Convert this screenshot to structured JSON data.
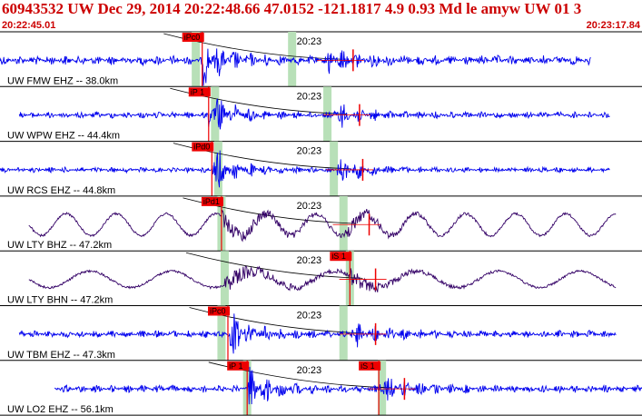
{
  "header": {
    "title": "60943532 UW Dec 29, 2014 20:22:48.66   47.0152 -121.1817  4.9 0.93 Md le amyw UW 01   3",
    "time_start": "20:22:45.01",
    "time_end": "20:23:17.84"
  },
  "colors": {
    "header_text": "#cc0000",
    "trace_blue": "#0000ee",
    "trace_purple": "#330066",
    "pick_red": "#ee0000",
    "window_green": "#b8e0b8",
    "travel_curve": "#000000"
  },
  "minute_label": "20:23",
  "traces": [
    {
      "label": "UW FMW EHZ -- 38.0km",
      "color": "blue",
      "kind": "local",
      "pick_p": "iPc0",
      "pick_s": "",
      "p_frac": 0.315,
      "s_frac": 0.51,
      "green1": 0.305,
      "green2": 0.455,
      "amp": 0.18,
      "start": 0.0,
      "end": 0.92
    },
    {
      "label": "UW WPW EHZ -- 44.4km",
      "color": "blue",
      "kind": "local",
      "pick_p": "iP 1",
      "pick_s": "",
      "p_frac": 0.325,
      "s_frac": 0.52,
      "green1": 0.335,
      "green2": 0.51,
      "amp": 0.12,
      "start": 0.03,
      "end": 0.95
    },
    {
      "label": "UW RCS EHZ -- 44.8km",
      "color": "blue",
      "kind": "local",
      "pick_p": "iPd0",
      "pick_s": "",
      "p_frac": 0.33,
      "s_frac": 0.525,
      "green1": 0.34,
      "green2": 0.52,
      "amp": 0.1,
      "start": 0.0,
      "end": 0.95
    },
    {
      "label": "UW LTY BHZ -- 47.2km",
      "color": "purple",
      "kind": "long",
      "pick_p": "iPd1",
      "pick_s": "",
      "p_frac": 0.345,
      "s_frac": 0.535,
      "green1": 0.345,
      "green2": 0.535,
      "amp": 0.4,
      "start": 0.045,
      "end": 0.96
    },
    {
      "label": "UW LTY BHN -- 47.2km",
      "color": "purple",
      "kind": "long2",
      "pick_p": "",
      "pick_s": "iS 1",
      "p_frac": 0.35,
      "s_frac": 0.545,
      "green1": 0.35,
      "green2": 0.545,
      "amp": 0.3,
      "start": 0.045,
      "end": 0.96
    },
    {
      "label": "UW TBM EHZ -- 47.3km",
      "color": "blue",
      "kind": "local",
      "pick_p": "iPc0",
      "pick_s": "",
      "p_frac": 0.355,
      "s_frac": 0.545,
      "green1": 0.345,
      "green2": 0.535,
      "amp": 0.14,
      "start": 0.03,
      "end": 0.96
    },
    {
      "label": "UW LO2 EHZ -- 56.1km",
      "color": "blue",
      "kind": "local",
      "pick_p": "iP 1",
      "pick_s": "iS 1",
      "p_frac": 0.385,
      "s_frac": 0.59,
      "green1": 0.385,
      "green2": 0.595,
      "amp": 0.14,
      "start": 0.085,
      "end": 1.0
    }
  ]
}
